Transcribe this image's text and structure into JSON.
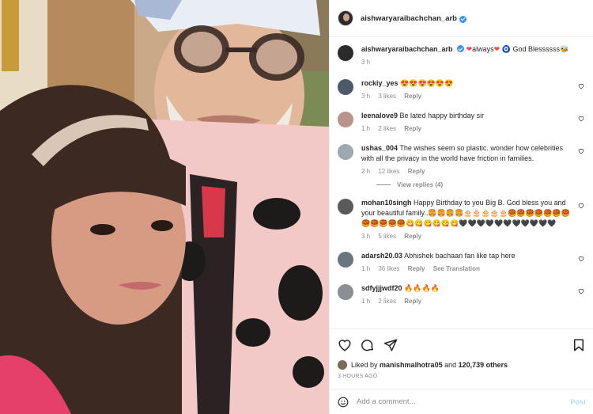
{
  "post": {
    "author": "aishwaryaraibachchan_arb",
    "caption_text": "always",
    "caption_blessing": "God Blessssss",
    "caption_time": "3 h"
  },
  "colors": {
    "link_blue": "#3897f0",
    "muted": "#8e8e8e",
    "text": "#262626",
    "post_disabled": "#b2dffc",
    "heart_red": "#ed4956"
  },
  "comments": [
    {
      "user": "rockiy_yes",
      "text": "😍😍😍😍😍😍",
      "time": "3 h",
      "likes": "3 likes",
      "reply": "Reply",
      "avatar": "#4a5a6a"
    },
    {
      "user": "leenalove9",
      "text": "Be lated happy birthday sir",
      "time": "1 h",
      "likes": "2 likes",
      "reply": "Reply",
      "avatar": "#b7958a"
    },
    {
      "user": "ushas_004",
      "text": "The wishes seem so plastic. wonder how celebrities with all the privacy in the world have friction in families.",
      "time": "2 h",
      "likes": "12 likes",
      "reply": "Reply",
      "avatar": "#9aa9b2"
    },
    {
      "user": "mohan10singh",
      "text": "Happy Birthday to you Big B. God bless you and your beautiful family..🍔🍔🍔🍔🎂🎂🎂🎂🎂🥮🥮🥮🥮🥮🥮🥮🥮🥮🥮🥮🥮😋😋😋😋😋😋🖤🖤🖤🖤🖤🖤🖤🖤🖤🖤🖤",
      "time": "3 h",
      "likes": "5 likes",
      "reply": "Reply",
      "avatar": "#5a5a5a"
    },
    {
      "user": "adarsh20.03",
      "text": "Abhishek bachaan fan like tap here",
      "time": "1 h",
      "likes": "36 likes",
      "reply": "Reply",
      "translation": "See Translation",
      "avatar": "#6a7580"
    },
    {
      "user": "sdfyjjjwdf20",
      "text": "🔥🔥🔥🔥",
      "time": "1 h",
      "likes": "2 likes",
      "reply": "Reply",
      "avatar": "#8a8f94"
    }
  ],
  "view_replies": "View replies (4)",
  "likes_line": {
    "prefix": "Liked by",
    "user": "manishmalhotra05",
    "middle": "and",
    "count": "120,739 others"
  },
  "timestamp": "3 HOURS AGO",
  "add_comment": {
    "placeholder": "Add a comment...",
    "post_label": "Post"
  },
  "icons": [
    "heart-icon",
    "comment-icon",
    "share-icon",
    "bookmark-icon",
    "emoji-icon",
    "verified-badge-icon"
  ]
}
